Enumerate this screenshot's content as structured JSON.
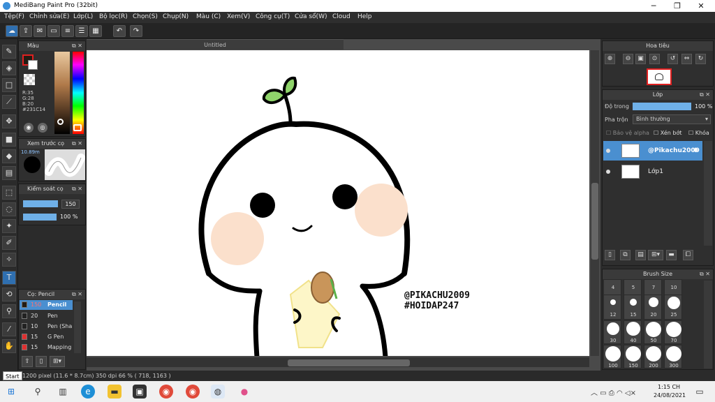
{
  "window": {
    "title": "MediBang Paint Pro (32bit)",
    "minimize": "─",
    "restore": "❐",
    "close": "✕"
  },
  "menu": [
    "Tệp(F)",
    "Chỉnh sửa(E)",
    "Lớp(L)",
    "Bộ lọc(R)",
    "Chọn(S)",
    "Chụp(N)",
    "Màu (C)",
    "Xem(V)",
    "Công cụ(T)",
    "Cửa sổ(W)",
    "Cloud",
    "Help"
  ],
  "document": {
    "tab_title": "Untitled"
  },
  "color_panel": {
    "title": "Màu",
    "r": "R:35",
    "g": "G:28",
    "b": "B:20",
    "hex": "#231C14",
    "current_color": "#231c14"
  },
  "brush_preview": {
    "title": "Xem trước cọ",
    "size": "10.89m"
  },
  "brush_control": {
    "title": "Kiểm soát cọ",
    "size_value": "150",
    "opacity_value": "100 %"
  },
  "brush_list": {
    "title": "Cọ: Pencil",
    "items": [
      {
        "size": "150",
        "name": "Pencil",
        "color": "#231c14"
      },
      {
        "size": "20",
        "name": "Pen",
        "color": "#222222"
      },
      {
        "size": "10",
        "name": "Pen (Sha",
        "color": "#222222"
      },
      {
        "size": "15",
        "name": "G Pen",
        "color": "#e03030"
      },
      {
        "size": "15",
        "name": "Mapping",
        "color": "#e03030"
      }
    ]
  },
  "navigator": {
    "title": "Hoa tiêu"
  },
  "layer_panel": {
    "title": "Lớp",
    "opacity_label": "Độ trong",
    "opacity_value": "100 %",
    "blend_label": "Pha trộn",
    "blend_value": "Bình thường",
    "protect_alpha": "Bảo vệ alpha",
    "clipping": "Xén bớt",
    "lock": "Khóa",
    "layers": [
      {
        "name": "@Pikachu2009",
        "selected": true
      },
      {
        "name": "Lớp1",
        "selected": false
      }
    ]
  },
  "brush_size": {
    "title": "Brush Size",
    "sizes": [
      "4",
      "5",
      "7",
      "10",
      "12",
      "15",
      "20",
      "25",
      "30",
      "40",
      "50",
      "70",
      "100",
      "150",
      "200",
      "300"
    ]
  },
  "canvas_text": {
    "line1": "@PIKACHU2009",
    "line2": "#HOIDAP247"
  },
  "status": {
    "info": "1200 pixel  (11.6 * 8.7cm)  350 dpi  66 %  ( 718, 1163 )",
    "start_tooltip": "Start"
  },
  "taskbar": {
    "time": "1:15 CH",
    "date": "24/08/2021"
  }
}
